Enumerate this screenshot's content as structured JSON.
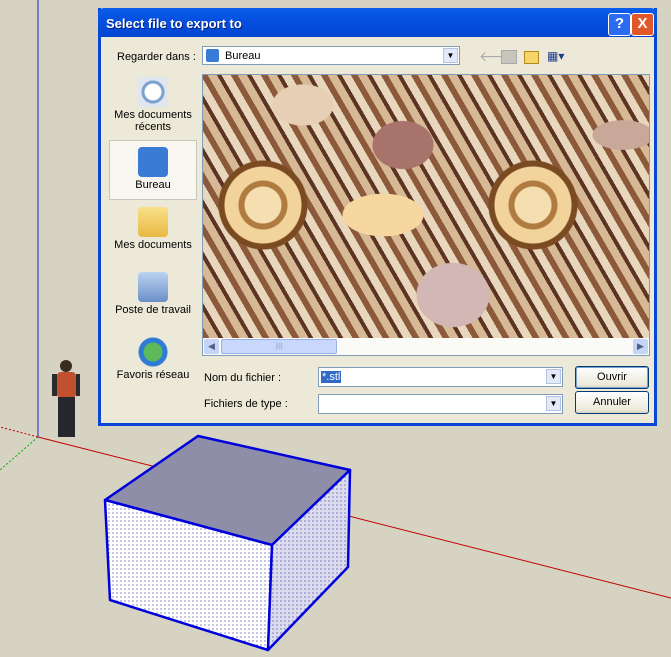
{
  "dialog": {
    "title": "Select file to export to",
    "look_in_label": "Regarder dans :",
    "look_in_value": "Bureau",
    "places": [
      {
        "label": "Mes documents récents",
        "icon": "recent-documents-icon"
      },
      {
        "label": "Bureau",
        "icon": "desktop-icon",
        "selected": true
      },
      {
        "label": "Mes documents",
        "icon": "my-documents-icon"
      },
      {
        "label": "Poste de travail",
        "icon": "my-computer-icon"
      },
      {
        "label": "Favoris réseau",
        "icon": "network-places-icon"
      }
    ],
    "filename_label": "Nom du fichier :",
    "filename_value": "*.stl",
    "filetype_label": "Fichiers de type :",
    "filetype_value": "",
    "open_button": "Ouvrir",
    "cancel_button": "Annuler",
    "help_button": "?",
    "close_button": "X"
  },
  "colors": {
    "titlebar": "#0550e0",
    "axis_red": "#cc0000",
    "axis_blue": "#0000cc",
    "axis_green": "#00aa00",
    "box_edge": "#0000dd"
  }
}
